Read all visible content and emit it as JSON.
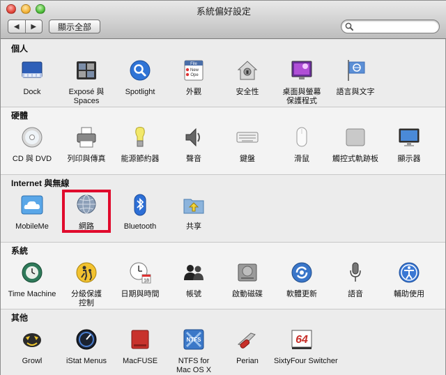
{
  "window": {
    "title": "系統偏好設定"
  },
  "toolbar": {
    "back": "◀",
    "forward": "▶",
    "show_all": "顯示全部"
  },
  "search": {
    "value": "",
    "placeholder": ""
  },
  "sections": {
    "personal": {
      "title": "個人",
      "items": [
        {
          "label": "Dock"
        },
        {
          "label": "Exposé 與\nSpaces"
        },
        {
          "label": "Spotlight"
        },
        {
          "label": "外觀"
        },
        {
          "label": "安全性"
        },
        {
          "label": "桌面與螢幕\n保護程式"
        },
        {
          "label": "語言與文字"
        }
      ]
    },
    "hardware": {
      "title": "硬體",
      "items": [
        {
          "label": "CD 與 DVD"
        },
        {
          "label": "列印與傳真"
        },
        {
          "label": "能源節約器"
        },
        {
          "label": "聲音"
        },
        {
          "label": "鍵盤"
        },
        {
          "label": "滑鼠"
        },
        {
          "label": "觸控式軌跡板"
        },
        {
          "label": "顯示器"
        }
      ]
    },
    "internet": {
      "title": "Internet 與無線",
      "items": [
        {
          "label": "MobileMe"
        },
        {
          "label": "網路"
        },
        {
          "label": "Bluetooth"
        },
        {
          "label": "共享"
        }
      ]
    },
    "system": {
      "title": "系統",
      "items": [
        {
          "label": "Time Machine"
        },
        {
          "label": "分級保護\n控制"
        },
        {
          "label": "日期與時間"
        },
        {
          "label": "帳號"
        },
        {
          "label": "啟動磁碟"
        },
        {
          "label": "軟體更新"
        },
        {
          "label": "語音"
        },
        {
          "label": "輔助使用"
        }
      ]
    },
    "other": {
      "title": "其他",
      "items": [
        {
          "label": "Growl"
        },
        {
          "label": "iStat Menus"
        },
        {
          "label": "MacFUSE"
        },
        {
          "label": "NTFS for\nMac OS X"
        },
        {
          "label": "Perian"
        },
        {
          "label": "SixtyFour Switcher"
        }
      ]
    }
  },
  "icon_text": {
    "appearance_file": "File",
    "appearance_new": "New",
    "appearance_open": "Ope",
    "date_day": "18",
    "ntfs": "NTFS",
    "sixtyfour": "64"
  }
}
